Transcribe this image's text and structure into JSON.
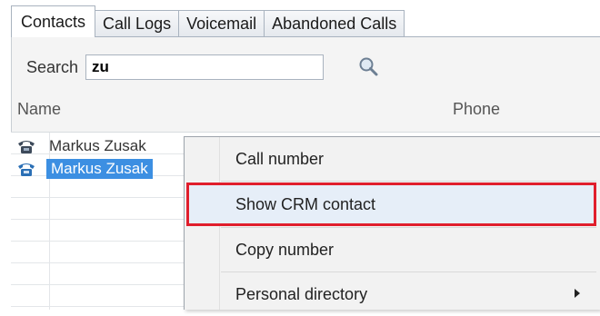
{
  "tabs": [
    {
      "label": "Contacts",
      "active": true
    },
    {
      "label": "Call Logs",
      "active": false
    },
    {
      "label": "Voicemail",
      "active": false
    },
    {
      "label": "Abandoned Calls",
      "active": false
    }
  ],
  "search": {
    "label": "Search",
    "value": "zu",
    "icon": "magnifier-icon"
  },
  "columns": {
    "name": "Name",
    "phone": "Phone"
  },
  "contacts": [
    {
      "name": "Markus Zusak",
      "selected": false,
      "icon": "telephone-icon"
    },
    {
      "name": "Markus Zusak",
      "selected": true,
      "icon": "telephone-icon"
    }
  ],
  "context_menu": {
    "items": [
      {
        "label": "Call number",
        "highlighted": false
      },
      {
        "label": "Show CRM contact",
        "highlighted": true
      },
      {
        "label": "Copy number",
        "highlighted": false
      },
      {
        "label": "Personal directory",
        "highlighted": false,
        "submenu": true
      }
    ]
  },
  "colors": {
    "selection": "#3c8fe2",
    "highlight_border": "#e01e2c"
  }
}
